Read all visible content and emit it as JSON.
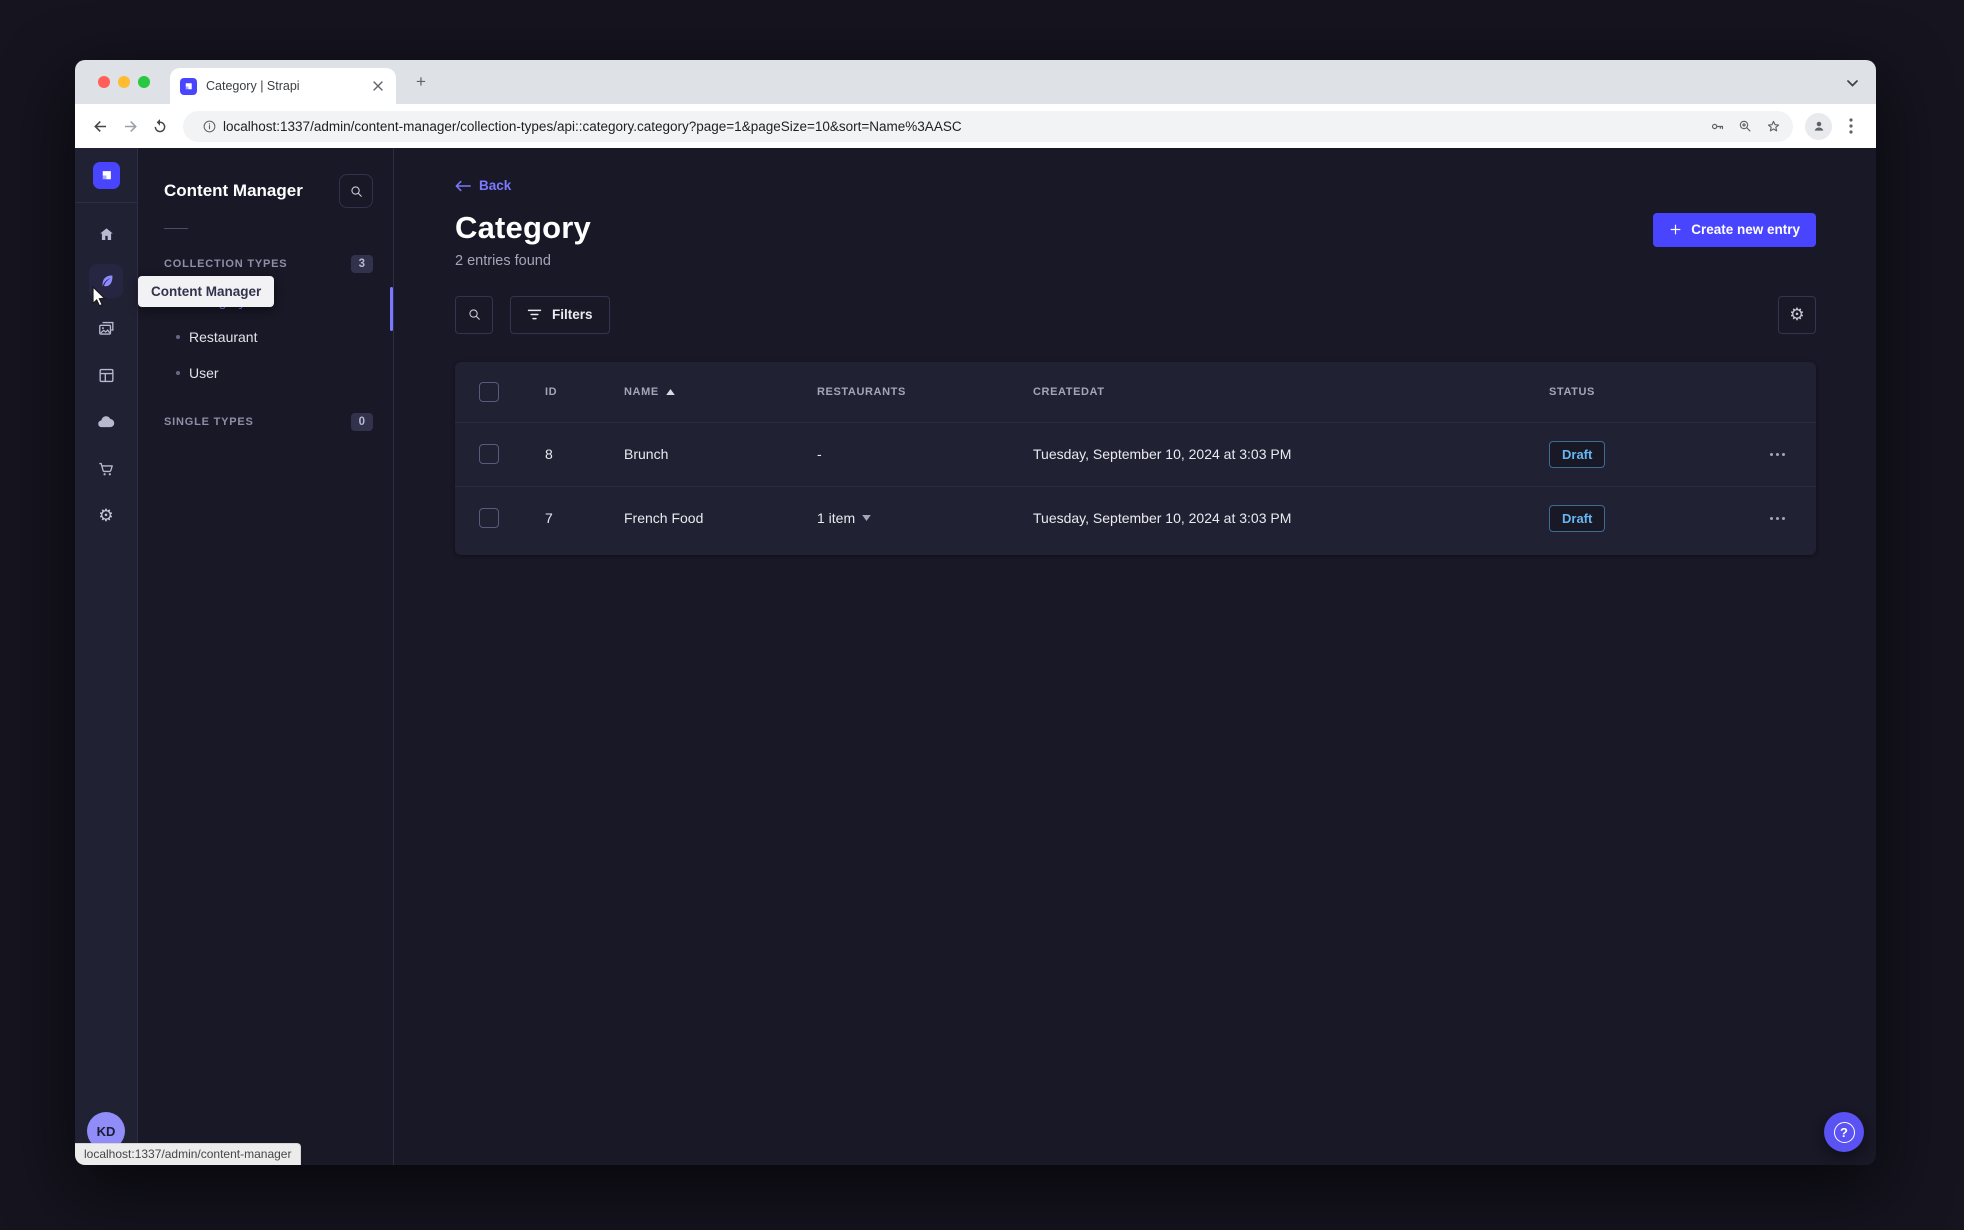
{
  "colors": {
    "primary": "#4945ff",
    "link": "#7b79ff",
    "draft_text": "#66b7f1",
    "page_bg": "#181826",
    "card_bg": "#212134"
  },
  "browser": {
    "tab_title": "Category | Strapi",
    "new_tab_button": "+",
    "url": "localhost:1337/admin/content-manager/collection-types/api::category.category?page=1&pageSize=10&sort=Name%3AASC",
    "status_url": "localhost:1337/admin/content-manager"
  },
  "navbar": {
    "tooltip": "Content Manager",
    "user_initials": "KD"
  },
  "subnav": {
    "title": "Content Manager",
    "collection_section": {
      "label": "COLLECTION TYPES",
      "count": "3"
    },
    "collection_items": [
      {
        "label": "Category"
      },
      {
        "label": "Restaurant"
      },
      {
        "label": "User"
      }
    ],
    "single_section": {
      "label": "SINGLE TYPES",
      "count": "0"
    }
  },
  "header": {
    "back": "Back",
    "title": "Category",
    "subtitle": "2 entries found",
    "create_button": "Create new entry"
  },
  "toolbar": {
    "filters_button": "Filters"
  },
  "table": {
    "headers": {
      "id": "ID",
      "name": "NAME",
      "restaurants": "RESTAURANTS",
      "createdat": "CREATEDAT",
      "status": "STATUS"
    },
    "rows": [
      {
        "id": "8",
        "name": "Brunch",
        "restaurants": "-",
        "createdat": "Tuesday, September 10, 2024 at 3:03 PM",
        "status": "Draft"
      },
      {
        "id": "7",
        "name": "French Food",
        "restaurants": "1 item",
        "createdat": "Tuesday, September 10, 2024 at 3:03 PM",
        "status": "Draft"
      }
    ]
  },
  "help": {
    "icon": "?"
  }
}
